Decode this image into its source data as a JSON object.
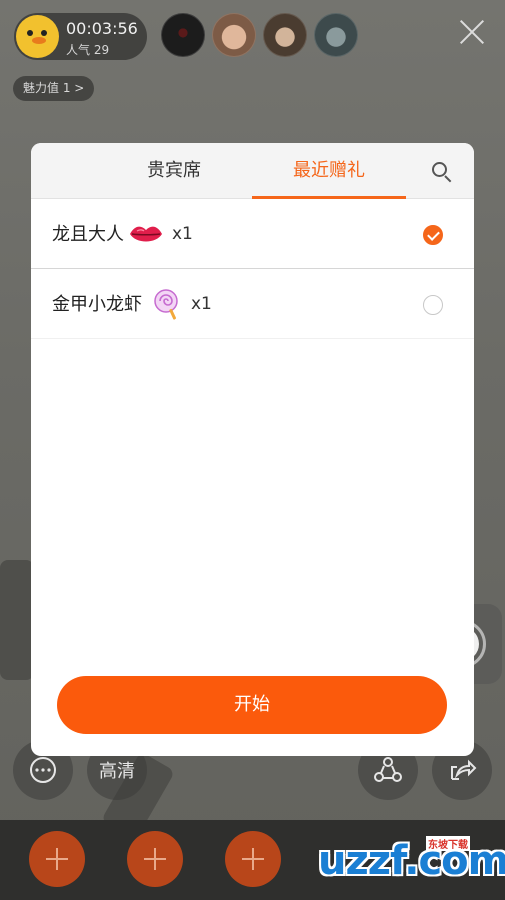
{
  "stream": {
    "host": {
      "timer": "00:03:56",
      "popularity": "人气 29"
    },
    "viewers": [
      {
        "name": "viewer-avatar-1",
        "color": "#2a2a2a"
      },
      {
        "name": "viewer-avatar-2",
        "color": "#c9a48a"
      },
      {
        "name": "viewer-avatar-3",
        "color": "#7a6a5a"
      },
      {
        "name": "viewer-avatar-4",
        "color": "#4d5a5c"
      }
    ],
    "charm_badge": "魅力值 1 >",
    "hd_label": "高清"
  },
  "modal": {
    "tabs": [
      {
        "label": "贵宾席",
        "active": false
      },
      {
        "label": "最近赠礼",
        "active": true
      }
    ],
    "gifts": [
      {
        "sender": "龙且大人",
        "gift_icon": "lips-icon",
        "quantity": "x1",
        "selected": true
      },
      {
        "sender": "金甲小龙虾",
        "gift_icon": "lollipop-icon",
        "quantity": "x1",
        "selected": false
      }
    ],
    "start_label": "开始"
  },
  "watermark": {
    "logo": "uzzf.com",
    "tagline": "东坡下载"
  },
  "colors": {
    "accent": "#f5661a",
    "button": "#fb5a0c"
  }
}
